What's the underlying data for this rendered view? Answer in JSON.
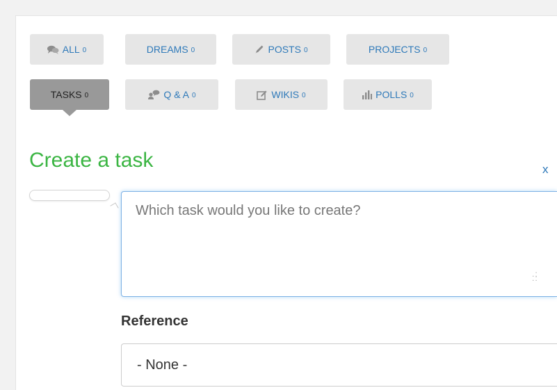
{
  "tabs": [
    {
      "key": "all",
      "label": "ALL",
      "count": "0",
      "icon": "comments-icon"
    },
    {
      "key": "dreams",
      "label": "DREAMS",
      "count": "0",
      "icon": ""
    },
    {
      "key": "posts",
      "label": "POSTS",
      "count": "0",
      "icon": "pencil-icon"
    },
    {
      "key": "projects",
      "label": "PROJECTS",
      "count": "0",
      "icon": ""
    },
    {
      "key": "tasks",
      "label": "TASKS",
      "count": "0",
      "icon": "",
      "active": true
    },
    {
      "key": "qa",
      "label": "Q & A",
      "count": "0",
      "icon": "user-chat-icon"
    },
    {
      "key": "wikis",
      "label": "WIKIS",
      "count": "0",
      "icon": "edit-icon"
    },
    {
      "key": "polls",
      "label": "POLLS",
      "count": "0",
      "icon": "bar-chart-icon"
    }
  ],
  "form": {
    "title": "Create a task",
    "close_label": "x",
    "task_placeholder": "Which task would you like to create?",
    "reference_label": "Reference",
    "reference_value": "- None -"
  },
  "colors": {
    "title_green": "#3bb543",
    "link_blue": "#2e79b9",
    "tab_bg": "#e6e6e6",
    "tab_active_bg": "#999999",
    "focus_blue": "#7fb2e5"
  }
}
